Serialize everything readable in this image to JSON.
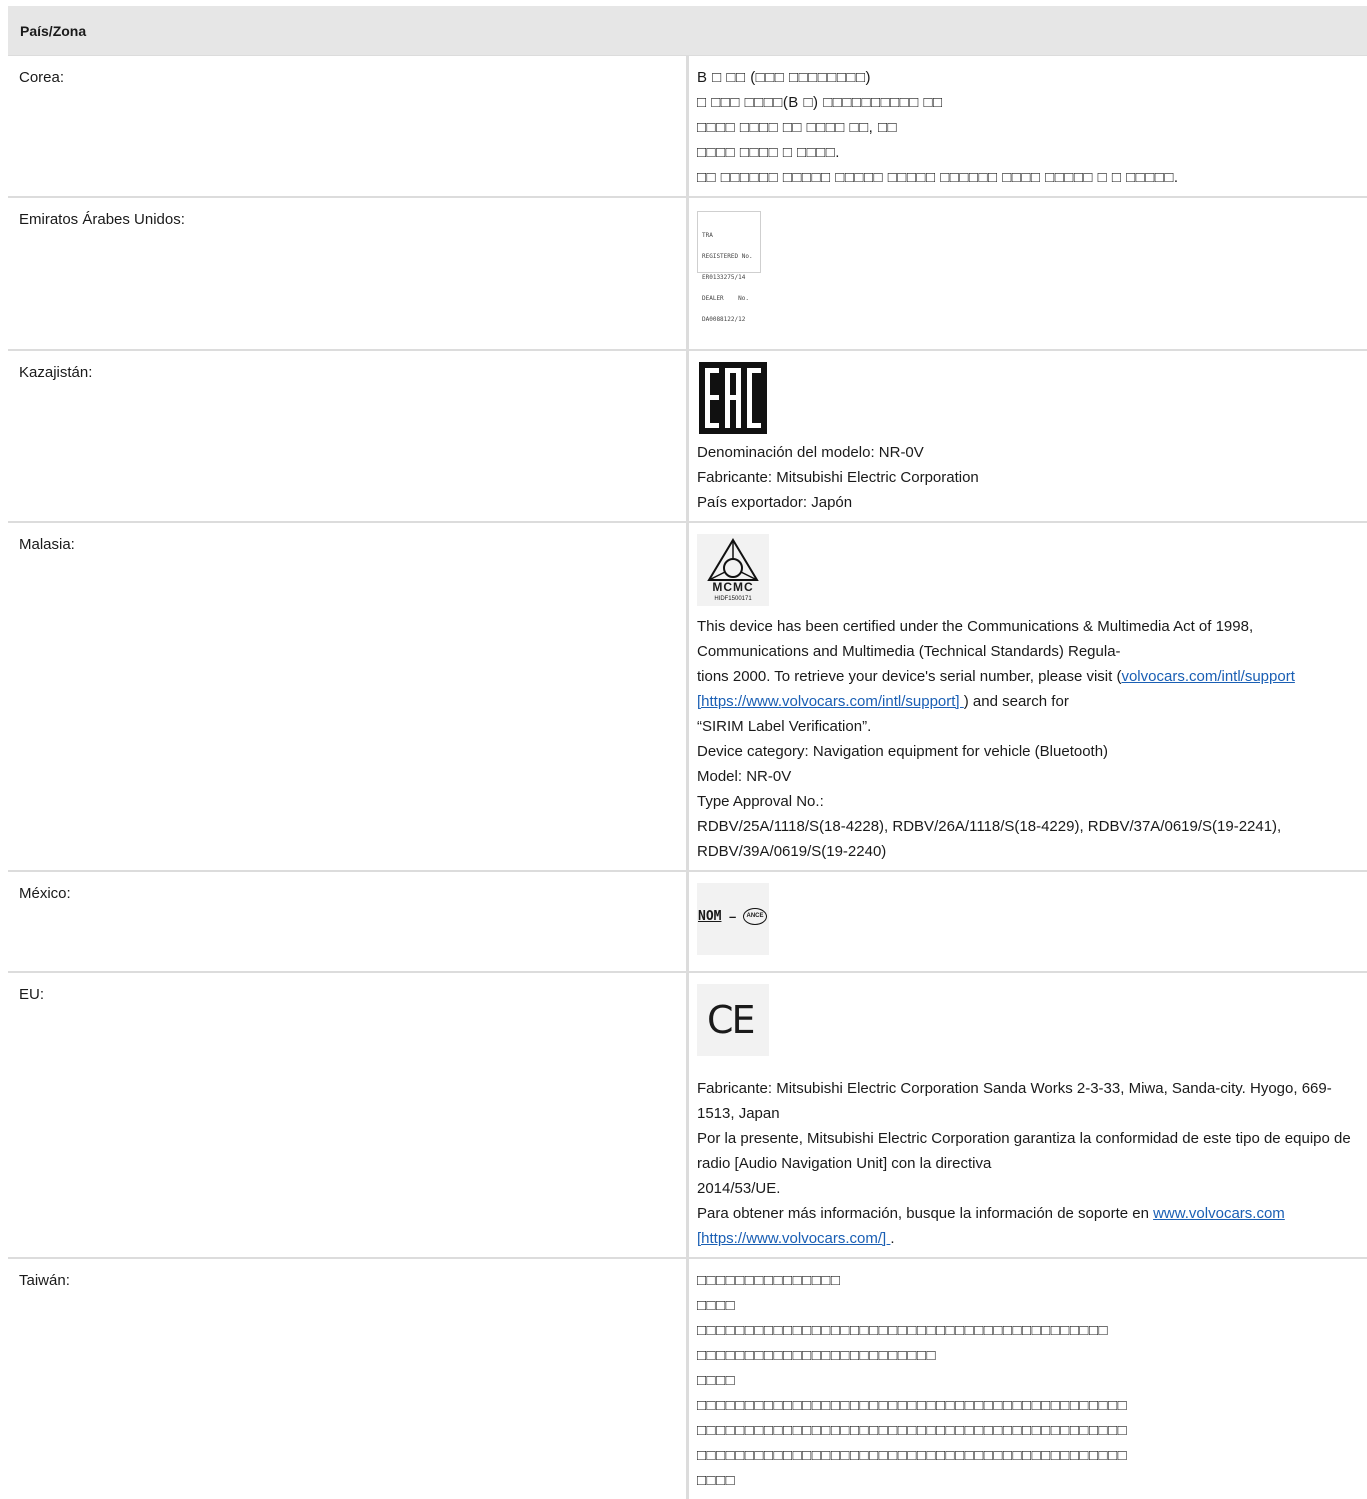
{
  "header": "País/Zona",
  "korea": {
    "country": "Corea:",
    "lines": [
      "B □ □□ (□□□ □□□□□□□□)",
      "□ □□□ □□□□(B □) □□□□□□□□□□ □□",
      "□□□□ □□□□ □□ □□□□ □□, □□",
      "□□□□ □□□□ □ □□□□.",
      "□□ □□□□□□ □□□□□ □□□□□ □□□□□ □□□□□□ □□□□ □□□□□ □ □ □□□□□."
    ]
  },
  "uae": {
    "country": "Emiratos Árabes Unidos:",
    "label_lines": [
      "TRA",
      "REGISTERED No.",
      "ER0133275/14",
      "DEALER    No.",
      "DA0088122/12"
    ]
  },
  "kazakhstan": {
    "country": "Kazajistán:",
    "logo_text": "EAC",
    "lines": [
      "Denominación del modelo: NR-0V",
      "Fabricante: Mitsubishi Electric Corporation",
      "País exportador: Japón"
    ]
  },
  "malaysia": {
    "country": "Malasia:",
    "logo_text": "MCMC",
    "logo_code": "HIDF1500171",
    "para_1_a": "This device has been certified under the Communications & Multimedia Act of 1998, Communications and Multimedia (Technical Standards) Regula-",
    "para_1_b": "tions 2000. To retrieve your device's serial number, please visit (",
    "link_text": "volvocars.com/intl/support [https://www.volvocars.com/intl/support] ",
    "para_1_c": ") and search for",
    "para_1_d": "“SIRIM Label Verification”.",
    "device_category": "Device category: Navigation equipment for vehicle (Bluetooth)",
    "model": "Model: NR-0V",
    "type_approval": "Type Approval No.:",
    "approval_numbers": "RDBV/25A/1118/S(18-4228), RDBV/26A/1118/S(18-4229), RDBV/37A/0619/S(19-2241), RDBV/39A/0619/S(19-2240)"
  },
  "mexico": {
    "country": "México:",
    "logo_nom": "NOM",
    "logo_dash": "–",
    "logo_ance": "ANCE"
  },
  "eu": {
    "country": "EU:",
    "logo_text": "CE",
    "manufacturer": "Fabricante: Mitsubishi Electric Corporation Sanda Works 2-3-33, Miwa, Sanda-city. Hyogo, 669-1513, Japan",
    "declaration_a": "Por la presente, Mitsubishi Electric Corporation garantiza la conformidad de este tipo de equipo de radio [Audio Navigation Unit] con la directiva",
    "declaration_b": "2014/53/UE.",
    "more_info": "Para obtener más información, busque la información de soporte en ",
    "link_text": "www.volvocars.com [https://www.volvocars.com/] ",
    "period": "."
  },
  "taiwan": {
    "country": "Taiwán:",
    "lines": [
      "□□□□□□□□□□□□□□□",
      "□□□□",
      "□□□□□□□□□□□□□□□□□□□□□□□□□□□□□□□□□□□□□□□□□□□",
      "□□□□□□□□□□□□□□□□□□□□□□□□□",
      "□□□□",
      "□□□□□□□□□□□□□□□□□□□□□□□□□□□□□□□□□□□□□□□□□□□□□",
      "□□□□□□□□□□□□□□□□□□□□□□□□□□□□□□□□□□□□□□□□□□□□□",
      "□□□□□□□□□□□□□□□□□□□□□□□□□□□□□□□□□□□□□□□□□□□□□",
      "□□□□"
    ]
  }
}
